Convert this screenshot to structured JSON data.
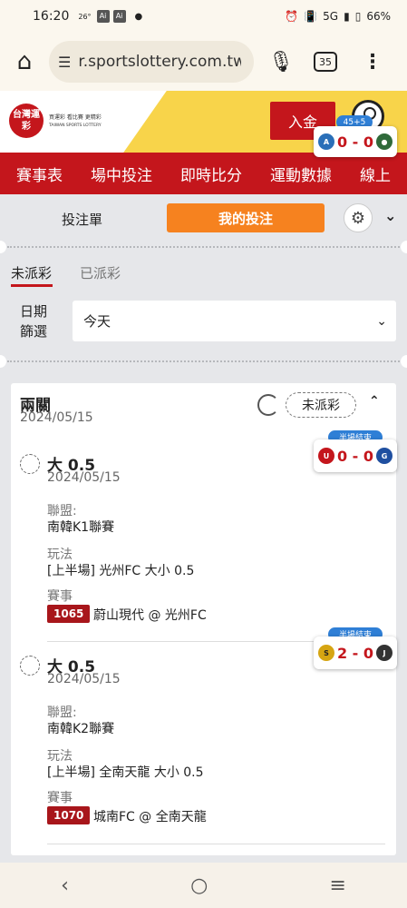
{
  "status_bar": {
    "time": "16:20",
    "mini": "26°",
    "ai1": "Ai",
    "ai2": "Ai",
    "network": "5G",
    "battery": "66%"
  },
  "browser": {
    "url": "r.sportslottery.com.tw",
    "tab_count": "35"
  },
  "header": {
    "logo_text": "台灣運彩",
    "logo_tagline": "買運彩 看比賽 更精彩",
    "logo_sub": "TAIWAN SPORTS LOTTERY",
    "deposit_label": "入金"
  },
  "score_widgets": [
    {
      "tag": "45+5",
      "score": "0 - 0"
    },
    {
      "tag": "半場結束",
      "score": "0 - 0"
    },
    {
      "tag": "半場結束",
      "score": "2 - 0"
    }
  ],
  "nav": {
    "items": [
      "賽事表",
      "場中投注",
      "即時比分",
      "運動數據",
      "線上"
    ]
  },
  "bet_tabs": {
    "slip_label": "投注單",
    "mybets_label": "我的投注"
  },
  "sub_tabs": {
    "unsettled": "未派彩",
    "settled": "已派彩"
  },
  "date_filter": {
    "label": "日期篩選",
    "value": "今天"
  },
  "card": {
    "title": "兩關",
    "date": "2024/05/15",
    "status": "未派彩",
    "labels": {
      "league": "聯盟:",
      "play": "玩法",
      "event": "賽事"
    },
    "items": [
      {
        "selection": "大 0.5",
        "date": "2024/05/15",
        "league": "南韓K1聯賽",
        "play": "[上半場] 光州FC 大小 0.5",
        "event_id": "1065",
        "event_name": "蔚山現代 @ 光州FC"
      },
      {
        "selection": "大 0.5",
        "date": "2024/05/15",
        "league": "南韓K2聯賽",
        "play": "[上半場] 全南天龍 大小 0.5",
        "event_id": "1070",
        "event_name": "城南FC @ 全南天龍"
      }
    ]
  },
  "colors": {
    "brand_red": "#c4161c",
    "accent_orange": "#f6821f",
    "header_yellow": "#f8d44a",
    "tag_blue": "#2f7fd6"
  }
}
